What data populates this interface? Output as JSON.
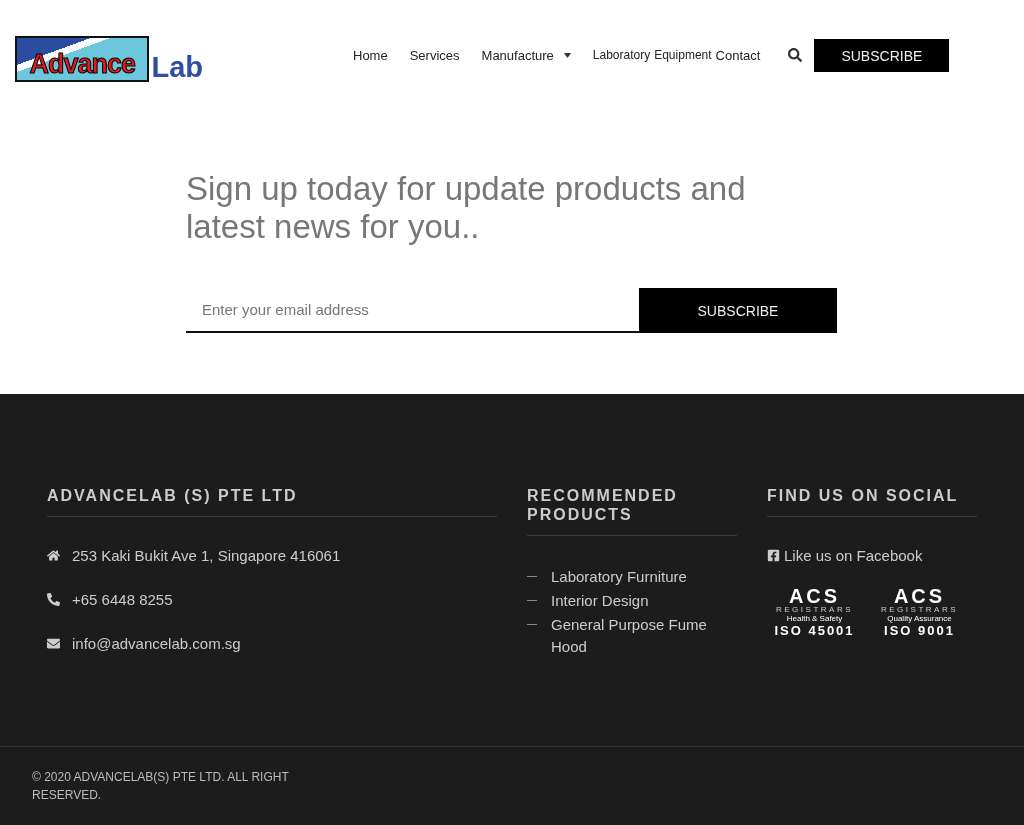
{
  "header": {
    "logo": {
      "word_1": "Advance",
      "word_2": "Lab"
    },
    "nav": [
      {
        "label": "Home",
        "kind": "link"
      },
      {
        "label": "Services",
        "kind": "link"
      },
      {
        "label": "Manufacture",
        "kind": "dropdown"
      },
      {
        "label": "Laboratory",
        "kind": "overlap"
      },
      {
        "label": "Equipment",
        "kind": "overlap"
      },
      {
        "label": "Contact",
        "kind": "link"
      }
    ],
    "subscribe_button": "SUBSCRIBE"
  },
  "signup": {
    "heading": "Sign up today for update products and latest news for you..",
    "email": {
      "placeholder": "Enter your email address"
    },
    "button": "SUBSCRIBE"
  },
  "footer": {
    "company": {
      "title": "ADVANCELAB (S) PTE LTD",
      "contacts": [
        {
          "kind": "address",
          "text": "253 Kaki Bukit Ave 1, Singapore 416061"
        },
        {
          "kind": "phone",
          "text": "+65 6448 8255"
        },
        {
          "kind": "email",
          "text": "info@advancelab.com.sg"
        }
      ]
    },
    "products": {
      "title": "RECOMMENDED PRODUCTS",
      "items": [
        "Laboratory Furniture",
        "Interior Design",
        "General Purpose Fume Hood"
      ]
    },
    "social": {
      "title": "FIND US ON SOCIAL",
      "facebook": "Like us on Facebook",
      "badges": [
        {
          "brand": "ACS",
          "registrars": "REGISTRARS",
          "subtitle": "Health & Safety",
          "standard": "ISO 45001"
        },
        {
          "brand": "ACS",
          "registrars": "REGISTRARS",
          "subtitle": "Quality Assurance",
          "standard": "ISO 9001"
        }
      ]
    },
    "copyright": "© 2020 ADVANCELAB(S) PTE LTD. ALL RIGHT RESERVED."
  }
}
